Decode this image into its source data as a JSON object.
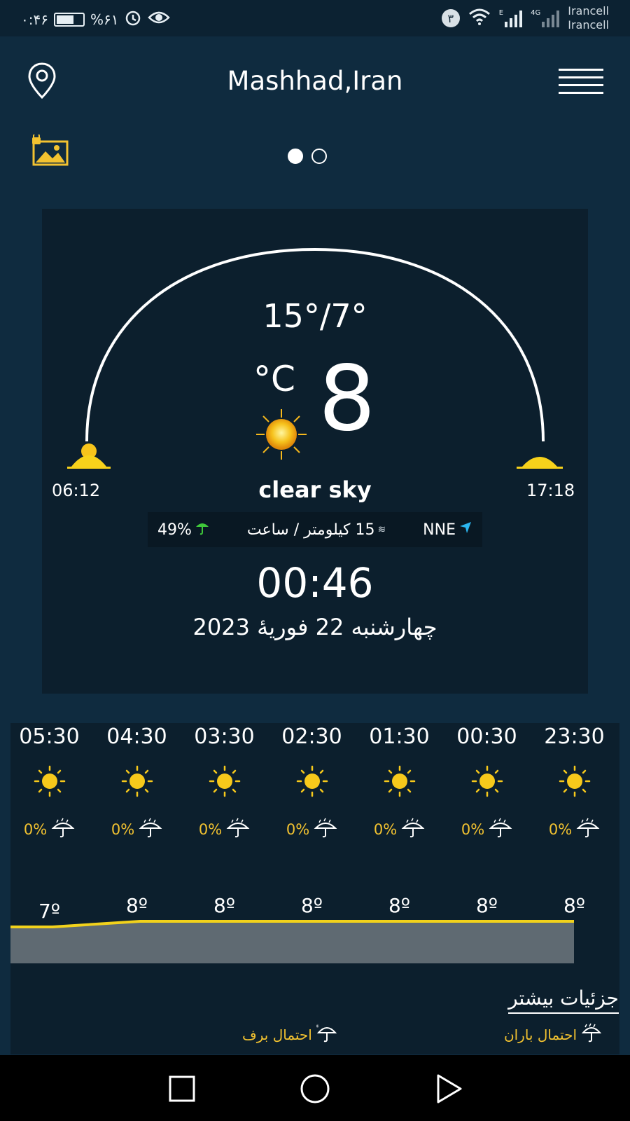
{
  "status_bar": {
    "time": "۰:۴۶",
    "battery": "%۶۱",
    "notification_count": "۳",
    "network_e": "E",
    "network_4g": "4G",
    "carrier_1": "Irancell",
    "carrier_2": "Irancell"
  },
  "header": {
    "location": "Mashhad,Iran",
    "location_icon": "location-pin-icon",
    "menu_icon": "hamburger-menu-icon",
    "wallpaper_icon": "locked-image-icon"
  },
  "pager": {
    "total": 2,
    "active": 0
  },
  "current": {
    "high_low": "15°/7°",
    "temp": "8",
    "unit": "°C",
    "condition": "clear sky",
    "sunrise": "06:12",
    "sunset": "17:18",
    "precip": "49%",
    "wind_speed": "15 کیلومتر / ساعت",
    "wind_dir": "NNE",
    "time": "00:46",
    "date": "چهارشنبه 22 فوریهٔ 2023"
  },
  "hourly": [
    {
      "time": "05:30",
      "rain": "0%",
      "temp": "7º"
    },
    {
      "time": "04:30",
      "rain": "0%",
      "temp": "8º"
    },
    {
      "time": "03:30",
      "rain": "0%",
      "temp": "8º"
    },
    {
      "time": "02:30",
      "rain": "0%",
      "temp": "8º"
    },
    {
      "time": "01:30",
      "rain": "0%",
      "temp": "8º"
    },
    {
      "time": "00:30",
      "rain": "0%",
      "temp": "8º"
    },
    {
      "time": "23:30",
      "rain": "0%",
      "temp": "8º"
    }
  ],
  "details": {
    "more_label": "جزئیات بیشتر",
    "rain_legend": "احتمال باران",
    "snow_legend": "احتمال برف"
  },
  "colors": {
    "background": "#0f2b3f",
    "card": "#0c1f2d",
    "accent_yellow": "#f2c230",
    "umbrella_green": "#3fc83a",
    "wind_arrow": "#2bb6f0"
  }
}
